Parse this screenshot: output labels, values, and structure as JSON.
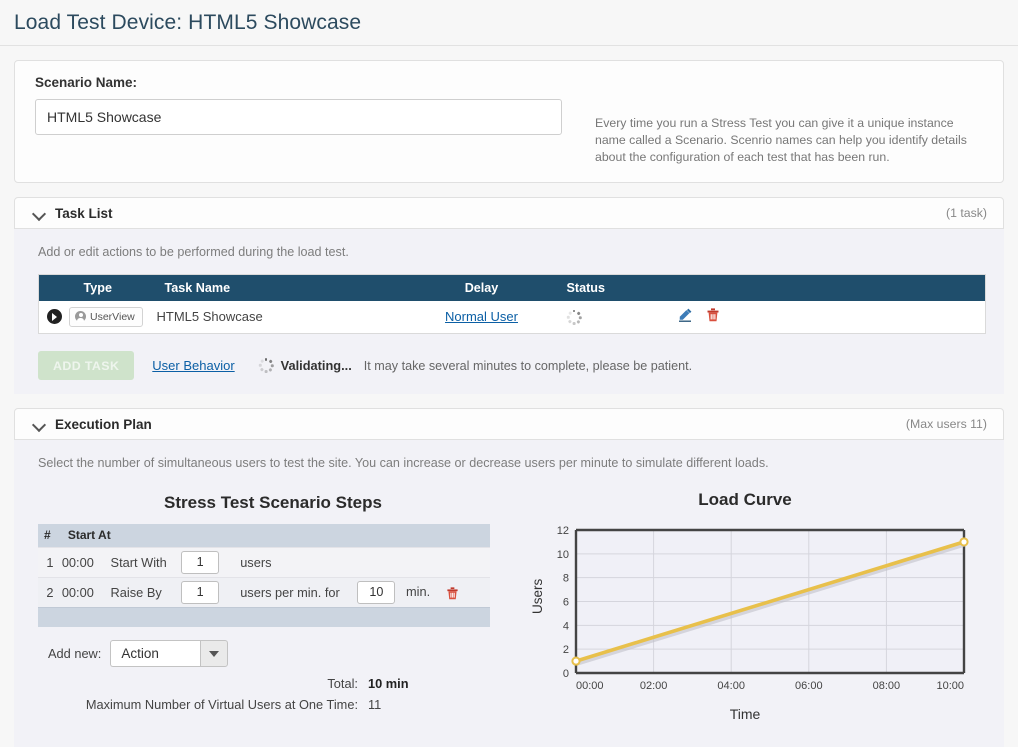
{
  "header": {
    "title": "Load Test Device: HTML5 Showcase"
  },
  "scenario": {
    "label": "Scenario Name:",
    "value": "HTML5 Showcase",
    "placeholder": "Scenario Name",
    "help": "Every time you run a Stress Test you can give it a unique instance name called a Scenario. Scenrio names can help you identify details about the configuration of each test that has been run."
  },
  "task_list": {
    "title": "Task List",
    "meta": "(1 task)",
    "description": "Add or edit actions to be performed during the load test.",
    "columns": [
      "Type",
      "Task Name",
      "Delay",
      "Status",
      ""
    ],
    "rows": [
      {
        "type_badge": "UserView",
        "name": "HTML5 Showcase",
        "delay": "Normal User",
        "status": "loading"
      }
    ],
    "add_task_label": "ADD TASK",
    "user_behavior_label": "User Behavior",
    "validating_label": "Validating...",
    "validating_note": "It may take several minutes to complete, please be patient."
  },
  "execution_plan": {
    "title": "Execution Plan",
    "meta": "(Max users 11)",
    "description": "Select the number of simultaneous users to test the site. You can increase or decrease users per minute to simulate different loads.",
    "steps_title": "Stress Test Scenario Steps",
    "steps_columns": [
      "#",
      "Start At"
    ],
    "steps": [
      {
        "num": "1",
        "start_at": "00:00",
        "action": "Start With",
        "value": "1",
        "unit": "users",
        "value2": "",
        "unit2": "",
        "deletable": false
      },
      {
        "num": "2",
        "start_at": "00:00",
        "action": "Raise By",
        "value": "1",
        "unit": "users per min. for",
        "value2": "10",
        "unit2": "min.",
        "deletable": true
      }
    ],
    "add_new_label": "Add new:",
    "add_new_value": "Action",
    "add_new_options": [
      "Action"
    ],
    "total_label": "Total:",
    "total_value": "10 min",
    "max_users_label": "Maximum Number of Virtual Users at One Time:",
    "max_users_value": "11"
  },
  "chart_data": {
    "type": "line",
    "title": "Load Curve",
    "xlabel": "Time",
    "ylabel": "Users",
    "x_ticks": [
      "00:00",
      "02:00",
      "04:00",
      "06:00",
      "08:00",
      "10:00"
    ],
    "y_ticks": [
      0,
      2,
      4,
      6,
      8,
      10,
      12
    ],
    "xlim": [
      0,
      10
    ],
    "ylim": [
      0,
      12
    ],
    "grid": true,
    "legend": "none",
    "line_color": "#e8c04b",
    "marker_color": "#ffffff",
    "series": [
      {
        "name": "Users",
        "x": [
          0,
          10
        ],
        "values": [
          1,
          11
        ]
      }
    ]
  },
  "colors": {
    "title": "#2c4a5e",
    "table_header": "#1f4e6c",
    "link": "#0b5fa5",
    "delete": "#c0392b",
    "edit": "#2e6da4",
    "chart_line": "#e8c04b"
  }
}
